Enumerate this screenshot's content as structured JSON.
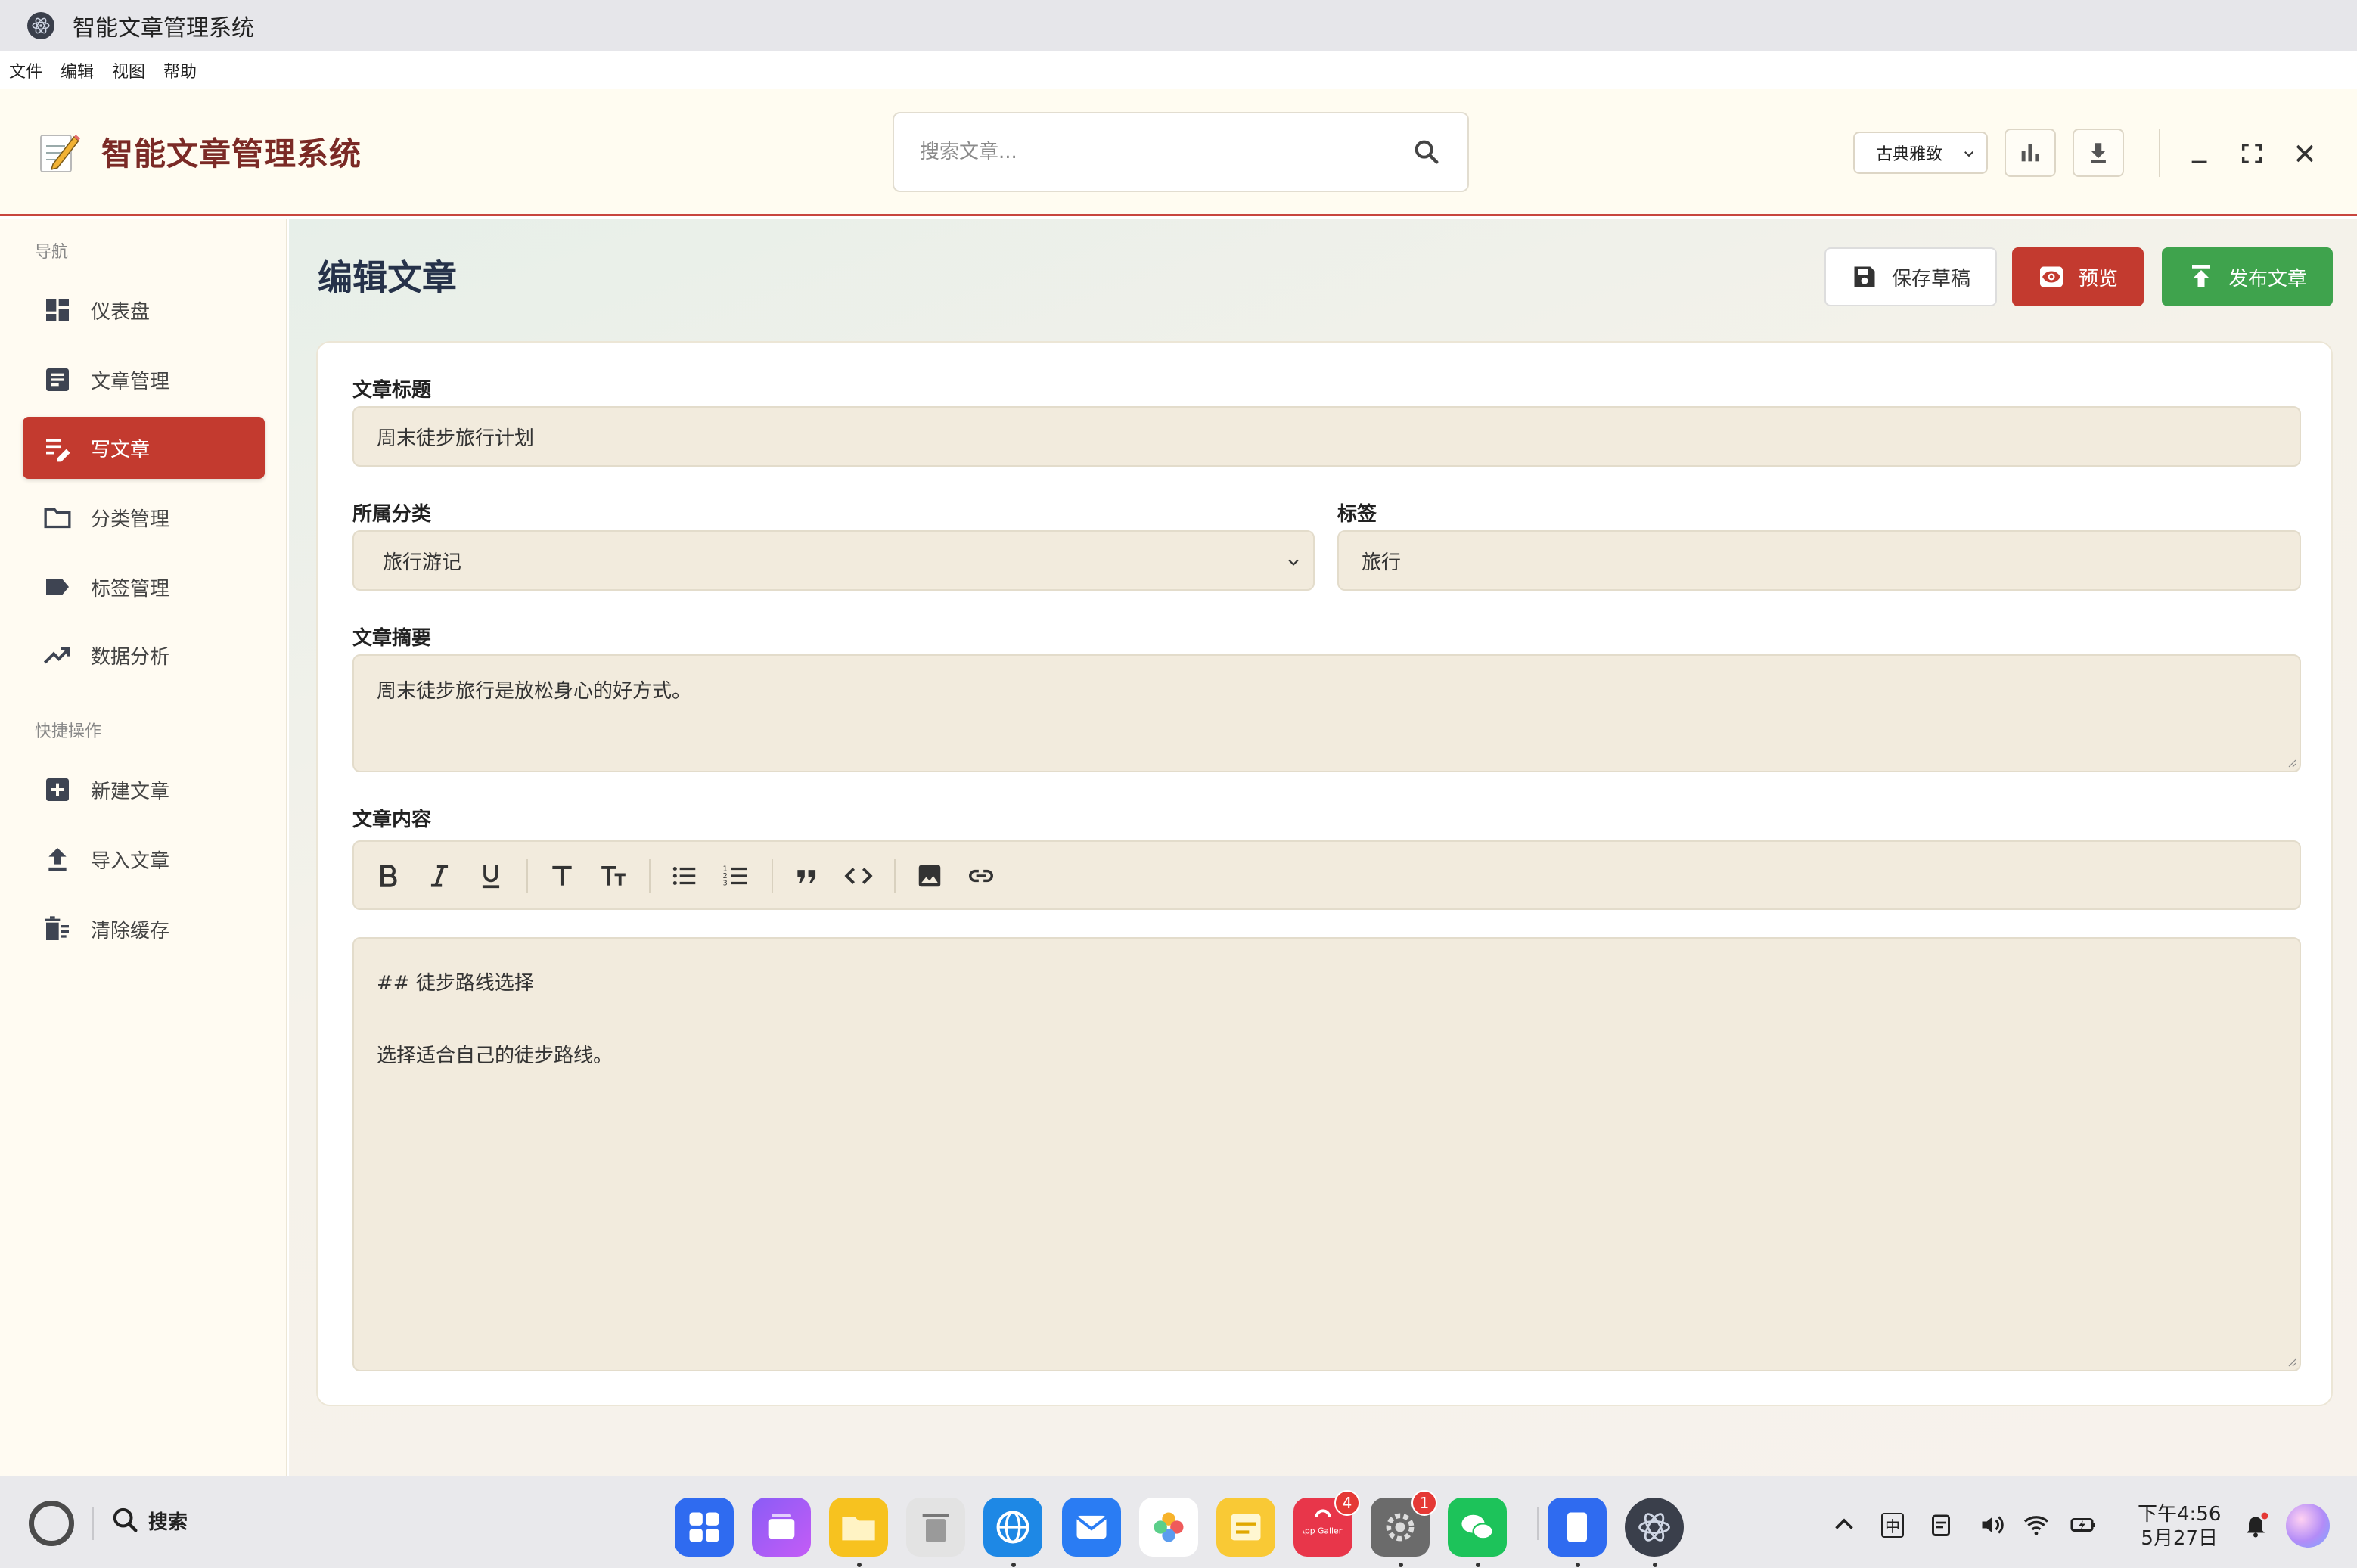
{
  "window": {
    "title": "智能文章管理系统"
  },
  "menu": [
    "文件",
    "编辑",
    "视图",
    "帮助"
  ],
  "header": {
    "brand_title": "智能文章管理系统",
    "search_placeholder": "搜索文章...",
    "theme_select": "古典雅致"
  },
  "sidebar": {
    "nav_section": "导航",
    "nav_items": [
      {
        "label": "仪表盘",
        "icon": "dashboard-icon"
      },
      {
        "label": "文章管理",
        "icon": "article-icon"
      },
      {
        "label": "写文章",
        "icon": "write-icon",
        "active": true
      },
      {
        "label": "分类管理",
        "icon": "folder-icon"
      },
      {
        "label": "标签管理",
        "icon": "tag-icon"
      },
      {
        "label": "数据分析",
        "icon": "trending-icon"
      }
    ],
    "quick_section": "快捷操作",
    "quick_items": [
      {
        "label": "新建文章",
        "icon": "plus-box-icon"
      },
      {
        "label": "导入文章",
        "icon": "upload-icon"
      },
      {
        "label": "清除缓存",
        "icon": "trash-icon"
      }
    ]
  },
  "main": {
    "page_title": "编辑文章",
    "buttons": {
      "save_draft": "保存草稿",
      "preview": "预览",
      "publish": "发布文章"
    },
    "form": {
      "title_label": "文章标题",
      "title_value": "周末徒步旅行计划",
      "category_label": "所属分类",
      "category_value": "旅行游记",
      "tags_label": "标签",
      "tags_value": "旅行",
      "summary_label": "文章摘要",
      "summary_value": "周末徒步旅行是放松身心的好方式。",
      "content_label": "文章内容",
      "content_lines": [
        "## 徒步路线选择",
        "",
        "选择适合自己的徒步路线。"
      ]
    }
  },
  "taskbar": {
    "search_label": "搜索",
    "app_gallery_label": "App Gallery",
    "badges": {
      "app_gallery": "4",
      "settings": "1"
    },
    "ime": "中",
    "time": "下午4:56",
    "date": "5月27日"
  },
  "colors": {
    "accent": "#c33a2f",
    "publish": "#3fa34d",
    "header_bg": "#fffcf1",
    "field_bg": "#f2ebdd"
  }
}
